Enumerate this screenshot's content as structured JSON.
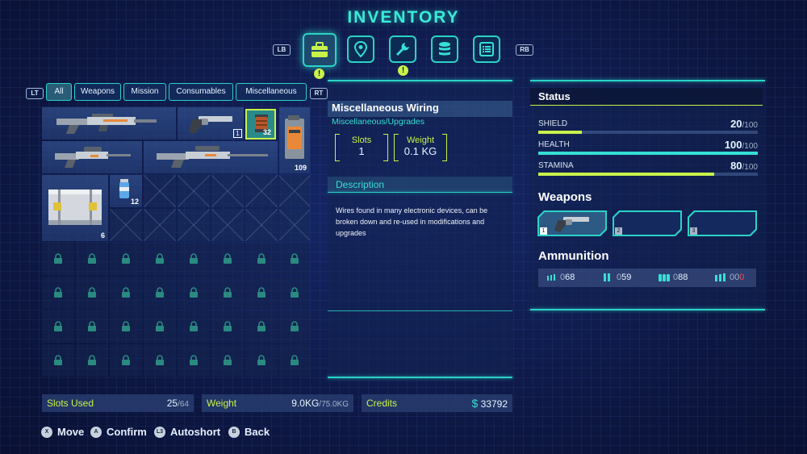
{
  "title": "INVENTORY",
  "shoulders": {
    "left": "LB",
    "right": "RB",
    "filter_left": "LT",
    "filter_right": "RT"
  },
  "tabs": [
    {
      "icon": "briefcase-icon",
      "active": true,
      "alert": true
    },
    {
      "icon": "map-pin-icon",
      "active": false,
      "alert": false
    },
    {
      "icon": "wrench-icon",
      "active": false,
      "alert": true
    },
    {
      "icon": "database-icon",
      "active": false,
      "alert": false
    },
    {
      "icon": "list-icon",
      "active": false,
      "alert": false
    }
  ],
  "alert_mark": "!",
  "filters": [
    "All",
    "Weapons",
    "Mission",
    "Consumables",
    "Miscellaneous"
  ],
  "inventory": {
    "quantities": {
      "revolver": "1",
      "wiring": "32",
      "canister": "109",
      "crate": "6",
      "vial": "12"
    }
  },
  "detail": {
    "name": "Miscellaneous Wiring",
    "category": "Miscellaneous/Upgrades",
    "slots_label": "Slots",
    "slots_value": "1",
    "weight_label": "Weight",
    "weight_value": "0.1 KG",
    "description_label": "Description",
    "description": "Wires found in many electronic devices, can be broken down and re-used in modifications and upgrades"
  },
  "status": {
    "title": "Status",
    "stats": [
      {
        "label": "SHIELD",
        "value": "20",
        "max": "/100",
        "fraction": 0.2,
        "color": "#c8f24a"
      },
      {
        "label": "HEALTH",
        "value": "100",
        "max": "/100",
        "fraction": 1.0,
        "color": "#35e0d4"
      },
      {
        "label": "STAMINA",
        "value": "80",
        "max": "/100",
        "fraction": 0.8,
        "color": "#c8f24a"
      }
    ]
  },
  "weapons": {
    "title": "Weapons",
    "slots": [
      "1",
      "2",
      "3"
    ]
  },
  "ammunition": {
    "title": "Ammunition",
    "items": [
      {
        "prefix": "0",
        "count": "68",
        "suffix": ""
      },
      {
        "prefix": "0",
        "count": "59",
        "suffix": ""
      },
      {
        "prefix": "0",
        "count": "88",
        "suffix": ""
      },
      {
        "prefix": "00",
        "count": "",
        "suffix": "0"
      }
    ]
  },
  "footer": {
    "slots_label": "Slots Used",
    "slots_used": "25",
    "slots_total": "/64",
    "weight_label": "Weight",
    "weight_used": "9.0KG",
    "weight_total": "/75.0KG",
    "credits_label": "Credits",
    "credits_symbol": "$",
    "credits_value": "33792"
  },
  "prompts": [
    {
      "button": "X",
      "label": "Move"
    },
    {
      "button": "A",
      "label": "Confirm"
    },
    {
      "button": "L3",
      "label": "Autoshort"
    },
    {
      "button": "B",
      "label": "Back"
    }
  ],
  "colors": {
    "accent": "#2ad3c6",
    "highlight": "#c8f24a",
    "background": "#0d1845",
    "ammo_empty": "#ff4a4a"
  }
}
